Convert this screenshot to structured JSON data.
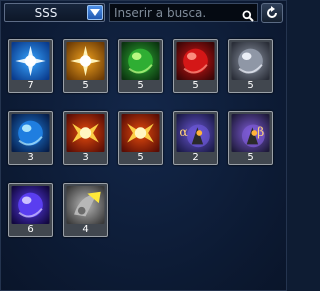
{
  "topbar": {
    "dropdown_value": "SSS",
    "search_placeholder": "Inserir a busca."
  },
  "items": [
    {
      "count": "7",
      "icon": "blue-starburst-icon",
      "colors": [
        "#0a3b8c",
        "#37a4ff",
        "#e7f6ff"
      ]
    },
    {
      "count": "5",
      "icon": "gold-starburst-icon",
      "colors": [
        "#6b3a05",
        "#f0a11d",
        "#fff3b8"
      ]
    },
    {
      "count": "5",
      "icon": "green-orb-icon",
      "colors": [
        "#0b3310",
        "#2fae33",
        "#c7ff8a"
      ]
    },
    {
      "count": "5",
      "icon": "red-orb-icon",
      "colors": [
        "#3a0606",
        "#d41717",
        "#ff9a8a"
      ]
    },
    {
      "count": "5",
      "icon": "white-orb-icon",
      "colors": [
        "#2a2e38",
        "#8f97a6",
        "#f4f7ff"
      ]
    },
    {
      "count": "3",
      "icon": "blue-sphere-icon",
      "colors": [
        "#061e4a",
        "#1f7ee0",
        "#b9efff"
      ]
    },
    {
      "count": "3",
      "icon": "fire-cross-icon",
      "colors": [
        "#5a0d05",
        "#e34a0d",
        "#ffd64a"
      ]
    },
    {
      "count": "5",
      "icon": "fire-cross-icon",
      "colors": [
        "#5a0d05",
        "#e34a0d",
        "#ffd64a"
      ]
    },
    {
      "count": "2",
      "icon": "alpha-creature-icon",
      "colors": [
        "#1a1a46",
        "#6b57d6",
        "#ffb23a"
      ]
    },
    {
      "count": "5",
      "icon": "beta-creature-icon",
      "colors": [
        "#1e1a3a",
        "#7d5bd6",
        "#ffb23a"
      ]
    },
    {
      "count": "6",
      "icon": "purple-vortex-icon",
      "colors": [
        "#12083f",
        "#5a3ef0",
        "#d7cfff"
      ]
    },
    {
      "count": "4",
      "icon": "yellow-horn-icon",
      "colors": [
        "#3a3a3a",
        "#b7b7b7",
        "#ffe93a"
      ]
    }
  ]
}
